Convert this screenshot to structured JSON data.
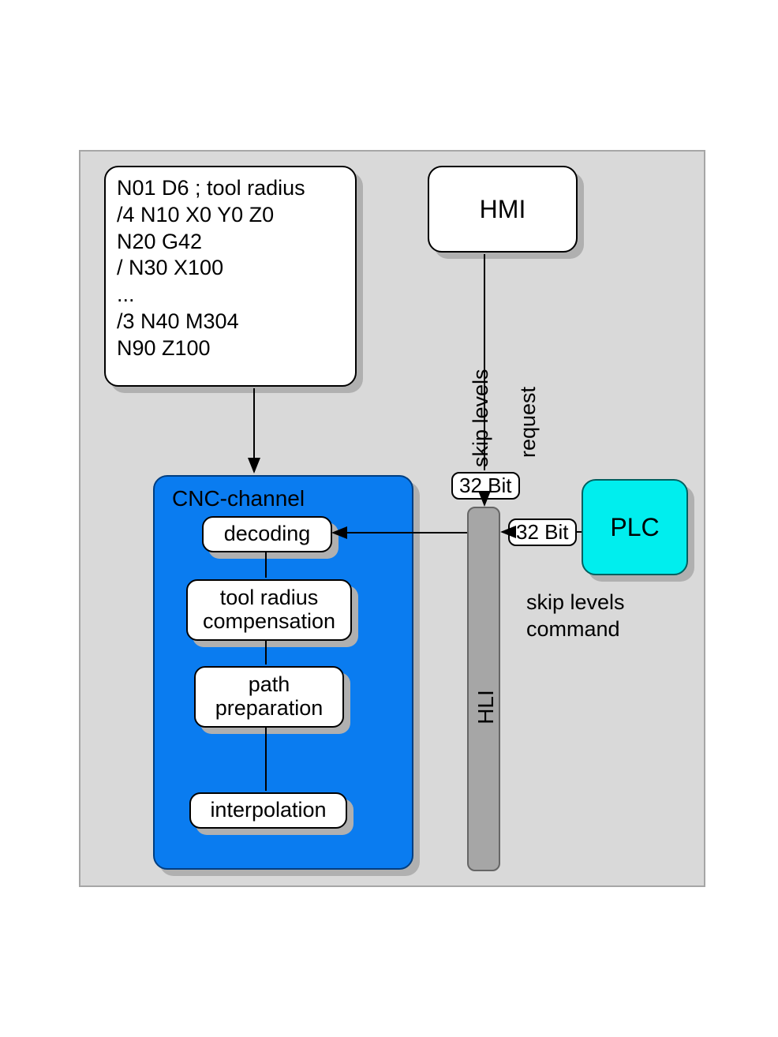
{
  "code": {
    "lines": [
      "N01 D6 ; tool radius",
      "/4 N10 X0 Y0 Z0",
      "N20 G42",
      "/ N30 X100",
      "...",
      "/3 N40 M304",
      "N90 Z100"
    ]
  },
  "hmi": {
    "label": "HMI"
  },
  "plc": {
    "label": "PLC"
  },
  "cnc": {
    "title": "CNC-channel",
    "steps": [
      "decoding",
      "tool radius compensation",
      "path preparation",
      "interpolation"
    ]
  },
  "hli": {
    "label": "HLI"
  },
  "bits": {
    "top": "32 Bit",
    "right": "32 Bit"
  },
  "labels": {
    "hmi_left": "skip levels",
    "hmi_right": "request",
    "plc_caption": "skip levels command"
  }
}
